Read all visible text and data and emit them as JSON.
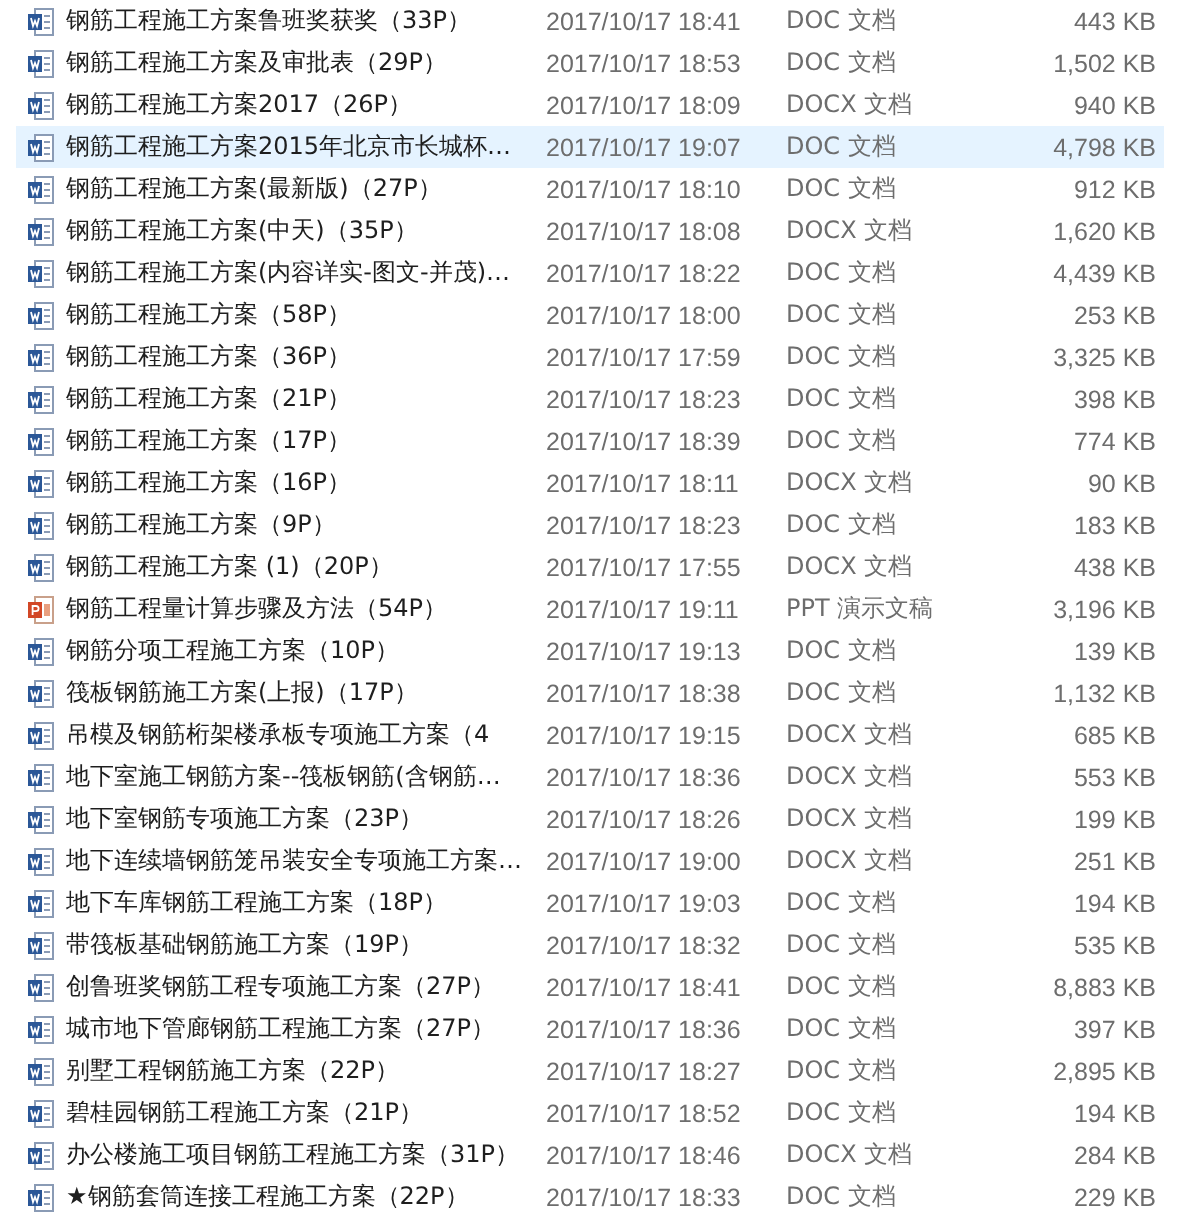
{
  "files": [
    {
      "name": "钢筋工程施工方案鲁班奖获奖（33P）",
      "date": "2017/10/17 18:41",
      "type": "DOC 文档",
      "size": "443 KB",
      "kind": "doc",
      "selected": false
    },
    {
      "name": "钢筋工程施工方案及审批表（29P）",
      "date": "2017/10/17 18:53",
      "type": "DOC 文档",
      "size": "1,502 KB",
      "kind": "doc",
      "selected": false
    },
    {
      "name": "钢筋工程施工方案2017（26P）",
      "date": "2017/10/17 18:09",
      "type": "DOCX 文档",
      "size": "940 KB",
      "kind": "doc",
      "selected": false
    },
    {
      "name": "钢筋工程施工方案2015年北京市长城杯…",
      "date": "2017/10/17 19:07",
      "type": "DOC 文档",
      "size": "4,798 KB",
      "kind": "doc",
      "selected": true
    },
    {
      "name": "钢筋工程施工方案(最新版)（27P）",
      "date": "2017/10/17 18:10",
      "type": "DOC 文档",
      "size": "912 KB",
      "kind": "doc",
      "selected": false
    },
    {
      "name": "钢筋工程施工方案(中天)（35P）",
      "date": "2017/10/17 18:08",
      "type": "DOCX 文档",
      "size": "1,620 KB",
      "kind": "doc",
      "selected": false
    },
    {
      "name": "钢筋工程施工方案(内容详实-图文-并茂)…",
      "date": "2017/10/17 18:22",
      "type": "DOC 文档",
      "size": "4,439 KB",
      "kind": "doc",
      "selected": false
    },
    {
      "name": "钢筋工程施工方案（58P）",
      "date": "2017/10/17 18:00",
      "type": "DOC 文档",
      "size": "253 KB",
      "kind": "doc",
      "selected": false
    },
    {
      "name": "钢筋工程施工方案（36P）",
      "date": "2017/10/17 17:59",
      "type": "DOC 文档",
      "size": "3,325 KB",
      "kind": "doc",
      "selected": false
    },
    {
      "name": "钢筋工程施工方案（21P）",
      "date": "2017/10/17 18:23",
      "type": "DOC 文档",
      "size": "398 KB",
      "kind": "doc",
      "selected": false
    },
    {
      "name": "钢筋工程施工方案（17P）",
      "date": "2017/10/17 18:39",
      "type": "DOC 文档",
      "size": "774 KB",
      "kind": "doc",
      "selected": false
    },
    {
      "name": "钢筋工程施工方案（16P）",
      "date": "2017/10/17 18:11",
      "type": "DOCX 文档",
      "size": "90 KB",
      "kind": "doc",
      "selected": false
    },
    {
      "name": "钢筋工程施工方案（9P）",
      "date": "2017/10/17 18:23",
      "type": "DOC 文档",
      "size": "183 KB",
      "kind": "doc",
      "selected": false
    },
    {
      "name": "钢筋工程施工方案 (1)（20P）",
      "date": "2017/10/17 17:55",
      "type": "DOCX 文档",
      "size": "438 KB",
      "kind": "doc",
      "selected": false
    },
    {
      "name": "钢筋工程量计算步骤及方法（54P）",
      "date": "2017/10/17 19:11",
      "type": "PPT 演示文稿",
      "size": "3,196 KB",
      "kind": "ppt",
      "selected": false
    },
    {
      "name": "钢筋分项工程施工方案（10P）",
      "date": "2017/10/17 19:13",
      "type": "DOC 文档",
      "size": "139 KB",
      "kind": "doc",
      "selected": false
    },
    {
      "name": "筏板钢筋施工方案(上报)（17P）",
      "date": "2017/10/17 18:38",
      "type": "DOC 文档",
      "size": "1,132 KB",
      "kind": "doc",
      "selected": false
    },
    {
      "name": "吊模及钢筋桁架楼承板专项施工方案（4",
      "date": "2017/10/17 19:15",
      "type": "DOCX 文档",
      "size": "685 KB",
      "kind": "doc",
      "selected": false
    },
    {
      "name": "地下室施工钢筋方案--筏板钢筋(含钢筋…",
      "date": "2017/10/17 18:36",
      "type": "DOCX 文档",
      "size": "553 KB",
      "kind": "doc",
      "selected": false
    },
    {
      "name": "地下室钢筋专项施工方案（23P）",
      "date": "2017/10/17 18:26",
      "type": "DOCX 文档",
      "size": "199 KB",
      "kind": "doc",
      "selected": false
    },
    {
      "name": "地下连续墙钢筋笼吊装安全专项施工方案…",
      "date": "2017/10/17 19:00",
      "type": "DOCX 文档",
      "size": "251 KB",
      "kind": "doc",
      "selected": false
    },
    {
      "name": "地下车库钢筋工程施工方案（18P）",
      "date": "2017/10/17 19:03",
      "type": "DOC 文档",
      "size": "194 KB",
      "kind": "doc",
      "selected": false
    },
    {
      "name": "带筏板基础钢筋施工方案（19P）",
      "date": "2017/10/17 18:32",
      "type": "DOC 文档",
      "size": "535 KB",
      "kind": "doc",
      "selected": false
    },
    {
      "name": "创鲁班奖钢筋工程专项施工方案（27P）",
      "date": "2017/10/17 18:41",
      "type": "DOC 文档",
      "size": "8,883 KB",
      "kind": "doc",
      "selected": false
    },
    {
      "name": "城市地下管廊钢筋工程施工方案（27P）",
      "date": "2017/10/17 18:36",
      "type": "DOC 文档",
      "size": "397 KB",
      "kind": "doc",
      "selected": false
    },
    {
      "name": "别墅工程钢筋施工方案（22P）",
      "date": "2017/10/17 18:27",
      "type": "DOC 文档",
      "size": "2,895 KB",
      "kind": "doc",
      "selected": false
    },
    {
      "name": "碧桂园钢筋工程施工方案（21P）",
      "date": "2017/10/17 18:52",
      "type": "DOC 文档",
      "size": "194 KB",
      "kind": "doc",
      "selected": false
    },
    {
      "name": "办公楼施工项目钢筋工程施工方案（31P）",
      "date": "2017/10/17 18:46",
      "type": "DOCX 文档",
      "size": "284 KB",
      "kind": "doc",
      "selected": false
    },
    {
      "name": "★钢筋套筒连接工程施工方案（22P）",
      "date": "2017/10/17 18:33",
      "type": "DOC 文档",
      "size": "229 KB",
      "kind": "doc",
      "selected": false
    }
  ]
}
